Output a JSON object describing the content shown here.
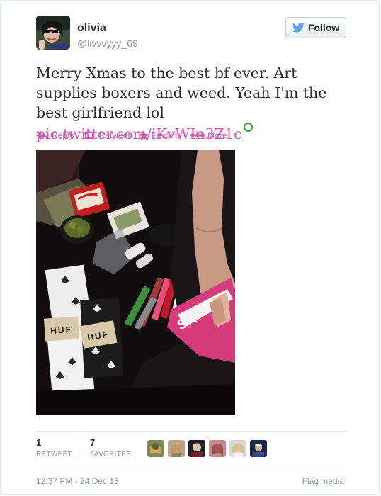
{
  "user": {
    "display_name": "olivia",
    "handle": "@livvvyyy_69"
  },
  "follow_label": "Follow",
  "tweet": {
    "text": "Merry Xmas to the best bf ever. Art supplies boxers and weed. Yeah I'm the best girlfriend lol ",
    "link": "pic.twitter.com/iKvWIn3Z1c"
  },
  "actions": {
    "reply": "Reply",
    "retweet": "Retweet",
    "favorite": "Favorite",
    "more": "More"
  },
  "media": {
    "sock_label_1": "HUF",
    "sock_label_2": "HUF"
  },
  "stats": {
    "retweets": {
      "count": "1",
      "label": "RETWEET"
    },
    "favorites": {
      "count": "7",
      "label": "FAVORITES"
    }
  },
  "timestamp": "12:37 PM - 24 Dec 13",
  "flag_label": "Flag media",
  "colors": {
    "link": "#d457b8",
    "follow_bird": "#55acee",
    "muted": "#8899a6"
  }
}
